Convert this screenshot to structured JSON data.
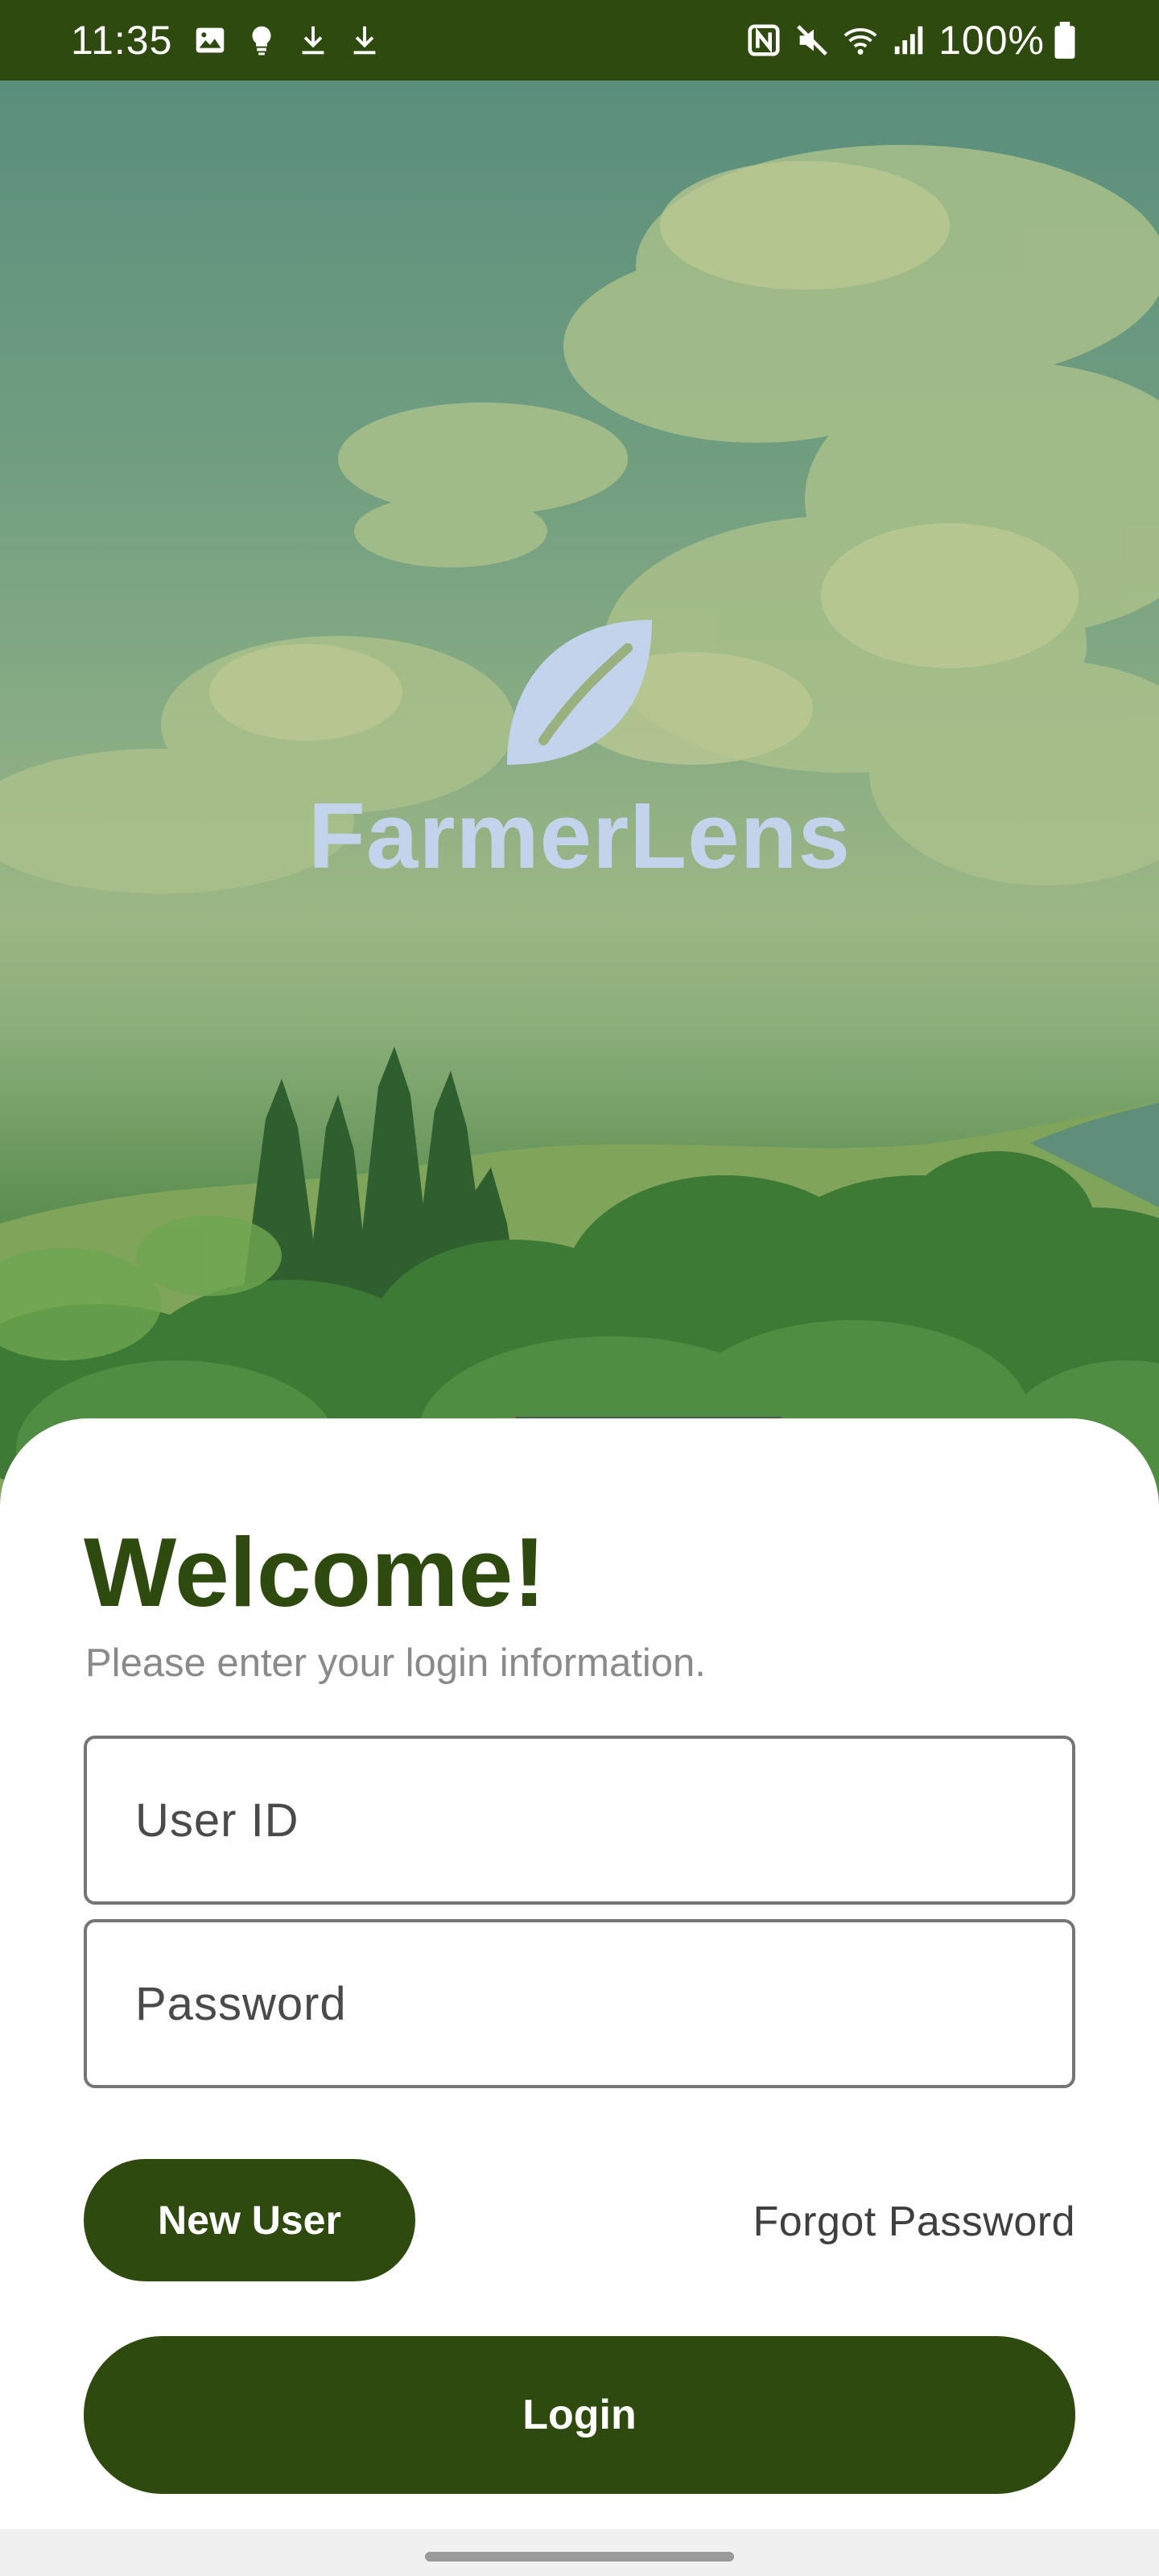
{
  "status_bar": {
    "time": "11:35",
    "battery_percent": "100%",
    "left_icons": [
      "gallery-icon",
      "lightbulb-icon",
      "download-icon",
      "download-icon"
    ],
    "right_icons": [
      "nfc-icon",
      "mute-icon",
      "wifi-icon",
      "signal-icon",
      "battery-icon"
    ],
    "background_color": "#2f4a0e"
  },
  "brand": {
    "app_name": "FarmerLens",
    "logo_icon": "leaf-icon",
    "logo_color": "#c3d3eb"
  },
  "login_card": {
    "title": "Welcome!",
    "subtitle": "Please enter your login information.",
    "user_id_field": {
      "placeholder": "User ID",
      "value": ""
    },
    "password_field": {
      "placeholder": "Password",
      "value": ""
    },
    "new_user_label": "New User",
    "forgot_password_label": "Forgot Password",
    "login_label": "Login"
  },
  "colors": {
    "primary": "#2f4a0e",
    "card_background": "#ffffff",
    "subtitle_text": "#8a8a8a"
  }
}
